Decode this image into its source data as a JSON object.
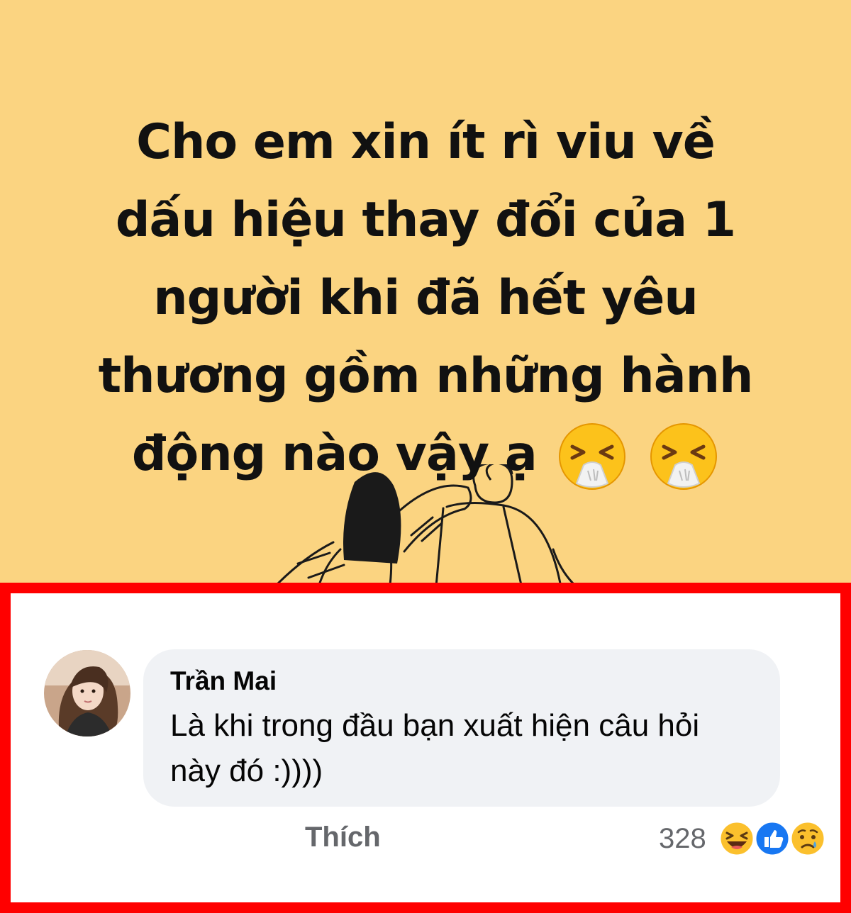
{
  "post": {
    "lines": [
      "Cho em xin ít rì viu về",
      "dấu hiệu thay đổi của 1",
      "người khi đã hết yêu",
      "thương gồm những hành",
      "động nào vậy ạ"
    ],
    "trailing_emojis": [
      "sneezing-face-icon",
      "sneezing-face-icon"
    ],
    "background_color": "#FBD481"
  },
  "comment": {
    "author": "Trần Mai",
    "text": "Là khi trong đầu bạn xuất hiện câu hỏi này đó :))))",
    "like_label": "Thích",
    "reaction_count": "328",
    "reactions": [
      "haha-icon",
      "like-icon",
      "sad-icon"
    ],
    "highlight_color": "#FF0000"
  }
}
